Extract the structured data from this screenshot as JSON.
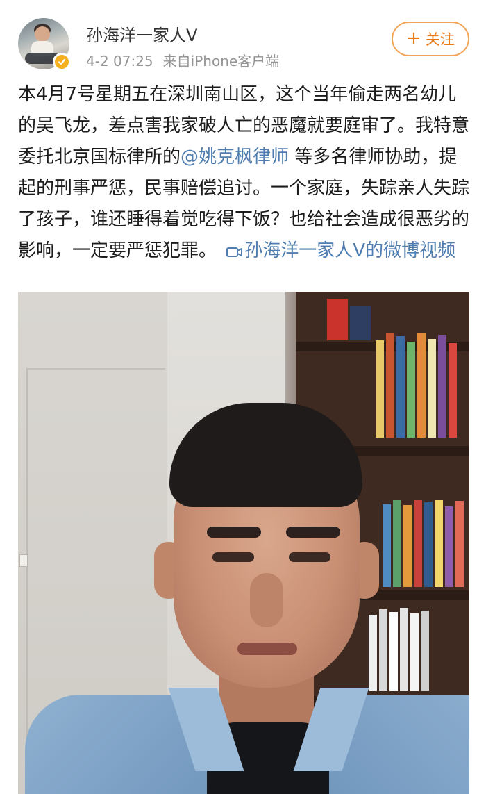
{
  "header": {
    "username": "孙海洋一家人V",
    "date": "4-2 07:25",
    "source": "来自iPhone客户端",
    "follow_label": "关注"
  },
  "post": {
    "text_1": "本4月7号星期五在深圳南山区，这个当年偷走两名幼儿的吴飞龙，差点害我家破人亡的恶魔就要庭审了。我特意委托北京国标律所的",
    "mention": "@姚克枫律师",
    "text_2": " 等多名律师协助，提起的刑事严惩，民事赔偿追讨。一个家庭，失踪亲人失踪了孩子，谁还睡得着觉吃得下饭？也给社会造成很恶劣的影响，一定要严惩犯罪。",
    "video_link": "孙海洋一家人V的微博视频"
  },
  "icons": {
    "avatar": "avatar-photo",
    "verified": "verified-badge-icon",
    "follow": "plus-icon",
    "video": "video-camera-icon"
  },
  "colors": {
    "link": "#507daf",
    "follow_accent": "#ea7a16",
    "verified": "#f6b01e",
    "meta_text": "#939393"
  }
}
